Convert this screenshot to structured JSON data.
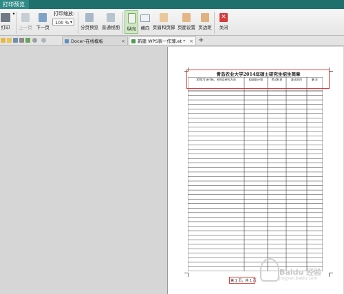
{
  "window": {
    "title": "打印预览"
  },
  "toolbar": {
    "print_label": "打印",
    "prev_label": "上一页",
    "next_label": "下一页",
    "zoom_label": "打印缩放:",
    "zoom_value": "100 %",
    "page_break_label": "分页预览",
    "normal_view_label": "普通视图",
    "portrait_label": "纵向",
    "landscape_label": "横向",
    "header_footer_label": "页眉和页脚",
    "page_setup_label": "页面设置",
    "margins_label": "页边距",
    "close_label": "关闭"
  },
  "tabs": [
    {
      "label": "Docer-在线模板"
    },
    {
      "label": "新建 WPS表一作薄.et *"
    }
  ],
  "document": {
    "title": "青岛农业大学2014年硕士研究生招生简章",
    "columns": [
      "学院(专业代码、名称及研究方向",
      "拟录取计划",
      "考试科目",
      "复试科目",
      "备 注"
    ],
    "footer": "第 1 页，共 1 页"
  },
  "watermark": {
    "text": "Baidu 经验",
    "sub": "jingyan.baidu.com"
  }
}
